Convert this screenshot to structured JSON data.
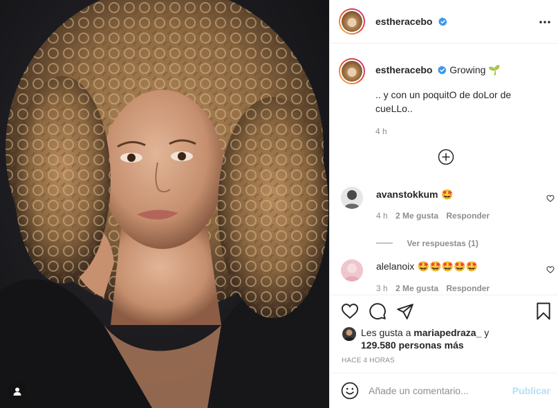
{
  "post": {
    "username": "estheracebo",
    "caption_title": "Growing",
    "caption_emoji": "🌱",
    "caption_body": ".. y con un poquitO de doLor de cueLLo..",
    "caption_time": "4 h",
    "more_icon": "more-horizontal-icon"
  },
  "comments": [
    {
      "username": "avanstokkum",
      "text": "🤩",
      "time": "4 h",
      "likes": "2 Me gusta",
      "reply": "Responder",
      "view_replies": "Ver respuestas (1)"
    },
    {
      "username": "alelanoix",
      "text": "🤩🤩🤩🤩🤩",
      "time": "3 h",
      "likes": "2 Me gusta",
      "reply": "Responder"
    }
  ],
  "likes_summary": {
    "prefix": "Les gusta a",
    "first_user": "mariapedraza_",
    "connector": "y",
    "others": "129.580 personas más"
  },
  "timestamp": "HACE 4 HORAS",
  "comment_box": {
    "placeholder": "Añade un comentario...",
    "publish_label": "Publicar"
  },
  "colors": {
    "verified": "#3897f0",
    "publish_disabled": "#b2dffc",
    "secondary_text": "#8e8e8e",
    "border": "#efefef"
  }
}
